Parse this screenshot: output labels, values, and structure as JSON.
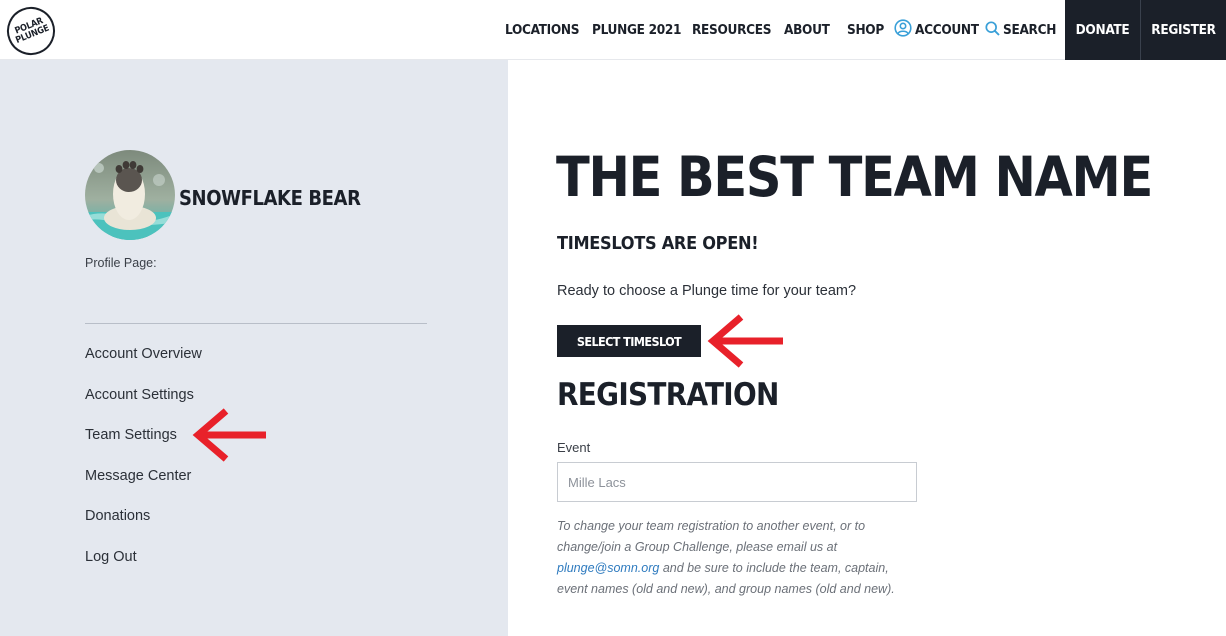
{
  "header": {
    "logo": {
      "line1": "POLAR",
      "line2": "PLUNGE"
    },
    "nav": [
      {
        "label": "LOCATIONS"
      },
      {
        "label": "PLUNGE 2021"
      },
      {
        "label": "RESOURCES"
      },
      {
        "label": "ABOUT"
      },
      {
        "label": "SHOP"
      }
    ],
    "account_label": "ACCOUNT",
    "search_label": "SEARCH",
    "donate_label": "DONATE",
    "register_label": "REGISTER"
  },
  "sidebar": {
    "profile_name": "SNOWFLAKE BEAR",
    "profile_page_label": "Profile Page:",
    "links": [
      {
        "label": "Account Overview"
      },
      {
        "label": "Account Settings"
      },
      {
        "label": "Team Settings"
      },
      {
        "label": "Message Center"
      },
      {
        "label": "Donations"
      },
      {
        "label": "Log Out"
      }
    ]
  },
  "main": {
    "title": "THE BEST TEAM NAME",
    "subhead": "TIMESLOTS ARE OPEN!",
    "prompt": "Ready to choose a Plunge time for your team?",
    "timeslot_button": "SELECT TIMESLOT",
    "registration_heading": "REGISTRATION",
    "event_label": "Event",
    "event_placeholder": "Mille Lacs",
    "note_before": "To change your team registration to another event, or to change/join a Group Challenge, please email us at",
    "note_email": "plunge@somn.org",
    "note_after": "and be sure to include the team, captain, event names (old and new), and group names (old and new)."
  },
  "colors": {
    "dark": "#1b2029",
    "sidebar_bg": "#e4e8ef",
    "accent_blue": "#3aa0d8",
    "annotation_red": "#e8212a"
  }
}
